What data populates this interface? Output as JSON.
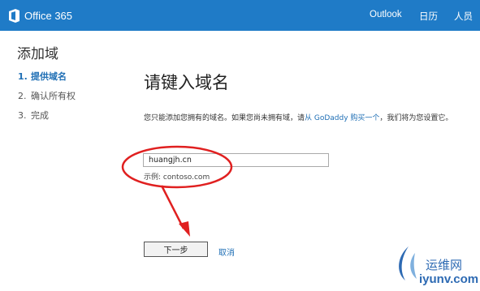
{
  "header": {
    "brand": "Office 365",
    "nav": [
      "Outlook",
      "日历",
      "人员"
    ],
    "accent_color": "#1f7bc7"
  },
  "sidebar": {
    "title": "添加域",
    "steps": [
      {
        "num": "1.",
        "label": "提供域名"
      },
      {
        "num": "2.",
        "label": "确认所有权"
      },
      {
        "num": "3.",
        "label": "完成"
      }
    ]
  },
  "main": {
    "heading": "请键入域名",
    "instruction_pre": "您只能添加您拥有的域名。如果您尚未拥有域，请",
    "instruction_link": "从 GoDaddy 购买一个",
    "instruction_post": "，我们将为您设置它。",
    "domain_value": "huangjh.cn",
    "example": "示例: contoso.com",
    "next_label": "下一步",
    "cancel_label": "取消"
  },
  "watermark": {
    "cn": "运维网",
    "en": "iyunv.com"
  }
}
